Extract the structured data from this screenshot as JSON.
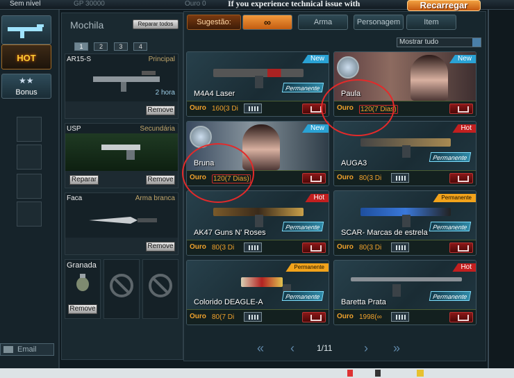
{
  "topbar": {
    "rank": "Sem nível",
    "gp": "GP 30000",
    "ouro": "Ouro 0",
    "issue_text": "If you experience technical issue with",
    "reload_label": "Recarregar"
  },
  "left_rail": {
    "hot_label": "HOT",
    "bonus_label": "Bonus",
    "email_label": "Email"
  },
  "inventory": {
    "title": "Mochila",
    "repair_all_label": "Reparar todos",
    "pages": [
      "1",
      "2",
      "3",
      "4"
    ],
    "slots": [
      {
        "name": "AR15-S",
        "category": "Principal",
        "time": "2 hora",
        "remove_label": "Remove"
      },
      {
        "name": "USP",
        "category": "Secundária",
        "repair_label": "Reparar",
        "remove_label": "Remove"
      },
      {
        "name": "Faca",
        "category": "Arma branca",
        "remove_label": "Remove"
      },
      {
        "name": "Granada",
        "remove_label": "Remove"
      }
    ]
  },
  "shop": {
    "tabs": {
      "suggestion": "Sugestão:",
      "all": "∞",
      "weapon": "Arma",
      "character": "Personagem",
      "item": "Item"
    },
    "filter_selected": "Mostrar tudo",
    "currency_label": "Ouro",
    "badges": {
      "new": "New",
      "hot": "Hot",
      "permanent": "Permanente"
    },
    "perm_tag": "Permanente",
    "cards": [
      {
        "title": "M4A4 Laser",
        "price": "160(3 Di",
        "badge": "New"
      },
      {
        "title": "Paula",
        "price": "120(7 Dias)",
        "badge": "New"
      },
      {
        "title": "Bruna",
        "price": "120(7 Dias)",
        "badge": "New"
      },
      {
        "title": "AUGA3",
        "price": "80(3 Di",
        "badge": "Hot"
      },
      {
        "title": "AK47 Guns N' Roses",
        "price": "80(3 Di",
        "badge": "Hot"
      },
      {
        "title": "SCAR- Marcas de estrela",
        "price": "80(3 Di",
        "badge": "Permanente"
      },
      {
        "title": "Colorido DEAGLE-A",
        "price": "80(7 Di",
        "badge": "Permanente"
      },
      {
        "title": "Baretta Prata",
        "price": "1998(∞",
        "badge": "Hot"
      }
    ],
    "pager": {
      "first": "«",
      "prev": "‹",
      "page": "1/11",
      "next": "›",
      "last": "»"
    }
  },
  "colors": {
    "accent_orange": "#f29a3c",
    "gold_price": "#f1a22c",
    "badge_new": "#2aa2d4",
    "badge_hot": "#c21f1f",
    "annotation_red": "#e32a2a"
  }
}
